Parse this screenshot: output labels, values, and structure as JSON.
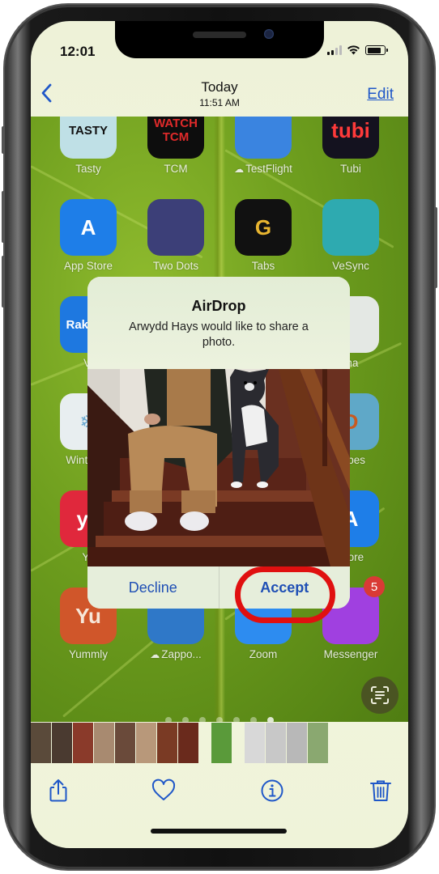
{
  "status_bar": {
    "time": "12:01",
    "signal_bars": 4,
    "signal_active": 2,
    "battery_level": 0.8,
    "icons": [
      "cellular-signal-icon",
      "wifi-icon",
      "battery-icon"
    ]
  },
  "nav": {
    "back_icon": "chevron-left-icon",
    "title": "Today",
    "subtitle": "11:51 AM",
    "edit_label": "Edit"
  },
  "home_screen_apps": [
    {
      "label": "Tasty",
      "icon_text": "TASTY",
      "bg": "#bfe0e6",
      "fg": "#111111"
    },
    {
      "label": "TCM",
      "icon_text": "WATCH TCM",
      "bg": "#0d0d0d",
      "fg": "#e02a2a"
    },
    {
      "label": "TestFlight",
      "icon_text": "",
      "bg": "#3a84e0",
      "fg": "#ffffff",
      "cloud": true
    },
    {
      "label": "Tubi",
      "icon_text": "tubi",
      "bg": "#14121f",
      "fg": "#ff3a3a"
    },
    {
      "label": "App Store",
      "icon_text": "A",
      "bg": "#1e7ee8",
      "fg": "#ffffff"
    },
    {
      "label": "Two Dots",
      "icon_text": "",
      "bg": "#3c3f78",
      "fg": "#ffffff"
    },
    {
      "label": "Tabs",
      "icon_text": "G",
      "bg": "#111111",
      "fg": "#e8b530"
    },
    {
      "label": "VeSync",
      "icon_text": "",
      "bg": "#2eaab0",
      "fg": "#ffffff"
    },
    {
      "label": "Vi",
      "icon_text": "Raku VI",
      "bg": "#1e78e0",
      "fg": "#ffffff"
    },
    {
      "label": "ma",
      "icon_text": "",
      "bg": "#e4e8e4",
      "fg": "#2a9a6a"
    },
    {
      "label": "WinterSu",
      "icon_text": "❄",
      "bg": "#e8eef0",
      "fg": "#6aa8d0"
    },
    {
      "label": "capes",
      "icon_text": "D",
      "bg": "#5fa8c8",
      "fg": "#c85a20"
    },
    {
      "label": "Ye",
      "icon_text": "ye",
      "bg": "#e0283c",
      "fg": "#ffffff"
    },
    {
      "label": "Store",
      "icon_text": "A",
      "bg": "#1e7ee8",
      "fg": "#ffffff"
    },
    {
      "label": "Yummly",
      "icon_text": "Yu",
      "bg": "#d0562a",
      "fg": "#f6e6d8"
    },
    {
      "label": "Zappo...",
      "icon_text": "",
      "bg": "#2f78c8",
      "fg": "#ffffff",
      "cloud": true
    },
    {
      "label": "Zoom",
      "icon_text": "",
      "bg": "#2d8cf0",
      "fg": "#ffffff"
    },
    {
      "label": "Messenger",
      "icon_text": "",
      "bg": "#a040e0",
      "fg": "#ffffff",
      "badge": "5"
    }
  ],
  "page_dots": {
    "count": 7,
    "active_index": 6
  },
  "airdrop_dialog": {
    "title": "AirDrop",
    "message": "Arwydd Hays would like to share a photo.",
    "decline_label": "Decline",
    "accept_label": "Accept",
    "photo_alt": "Person in tan overalls and a dog sitting on wooden stairs"
  },
  "highlight": {
    "target": "Accept",
    "color": "#e01010"
  },
  "livetext_icon": "live-text-icon",
  "filmstrip": {
    "thumbnail_count": 14
  },
  "toolbar": {
    "share_icon": "share-icon",
    "favorite_icon": "heart-icon",
    "info_icon": "info-icon",
    "delete_icon": "trash-icon"
  },
  "colors": {
    "accent": "#1f57c8",
    "badge": "#d93a35",
    "background": "#eef2d8"
  }
}
